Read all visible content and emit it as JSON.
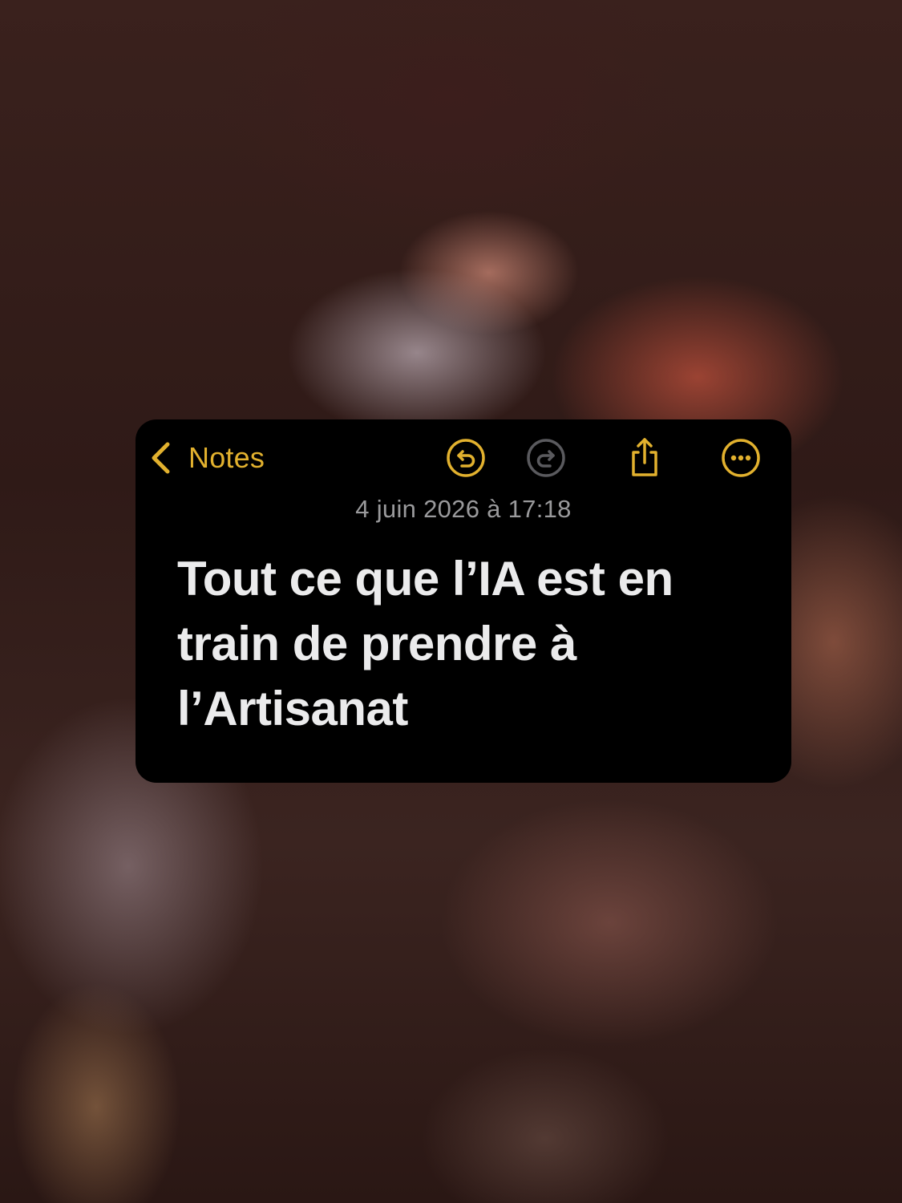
{
  "navigation": {
    "back_label": "Notes"
  },
  "toolbar": {
    "undo_icon": "undo-icon",
    "redo_icon": "redo-icon",
    "share_icon": "share-icon",
    "more_icon": "more-icon"
  },
  "note": {
    "date": "4 juin 2026 à 17:18",
    "title_lines": [
      "Tout ce que l’IA est en",
      "train de prendre à",
      "l’Artisanat"
    ]
  },
  "colors": {
    "accent": "#e2b12e",
    "disabled": "#5a5a5e",
    "card_background": "#000000",
    "title_text": "#ebebec",
    "date_text": "#9a9a9c"
  }
}
